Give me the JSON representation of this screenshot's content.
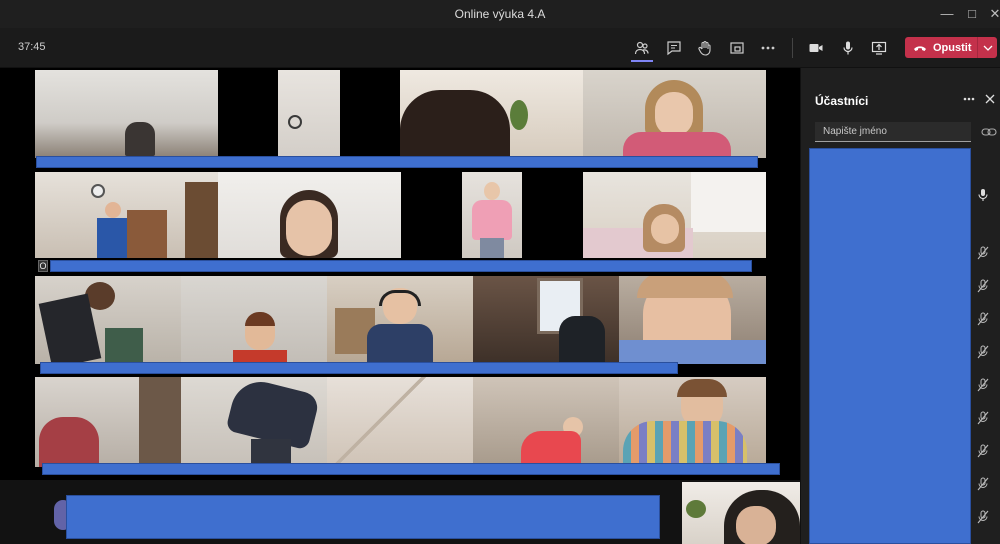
{
  "window": {
    "title": "Online výuka 4.A"
  },
  "toolbar": {
    "timer": "37:45",
    "leave_label": "Opustit",
    "icons": [
      "people-icon",
      "chat-icon",
      "raise-hand-icon",
      "share-tray-icon",
      "more-icon",
      "camera-icon",
      "mic-icon",
      "share-screen-icon"
    ]
  },
  "participants_panel": {
    "title": "Účastníci",
    "search_placeholder": "Napište jméno",
    "mic_states": [
      "on",
      "muted",
      "muted",
      "muted",
      "muted",
      "muted",
      "muted",
      "muted",
      "muted",
      "muted"
    ]
  },
  "video_grid": {
    "tile_label_visible": "O"
  },
  "colors": {
    "accent_leave": "#c4314b",
    "redaction_blue": "#3f6fcf",
    "app_dark": "#1f1f1f"
  }
}
